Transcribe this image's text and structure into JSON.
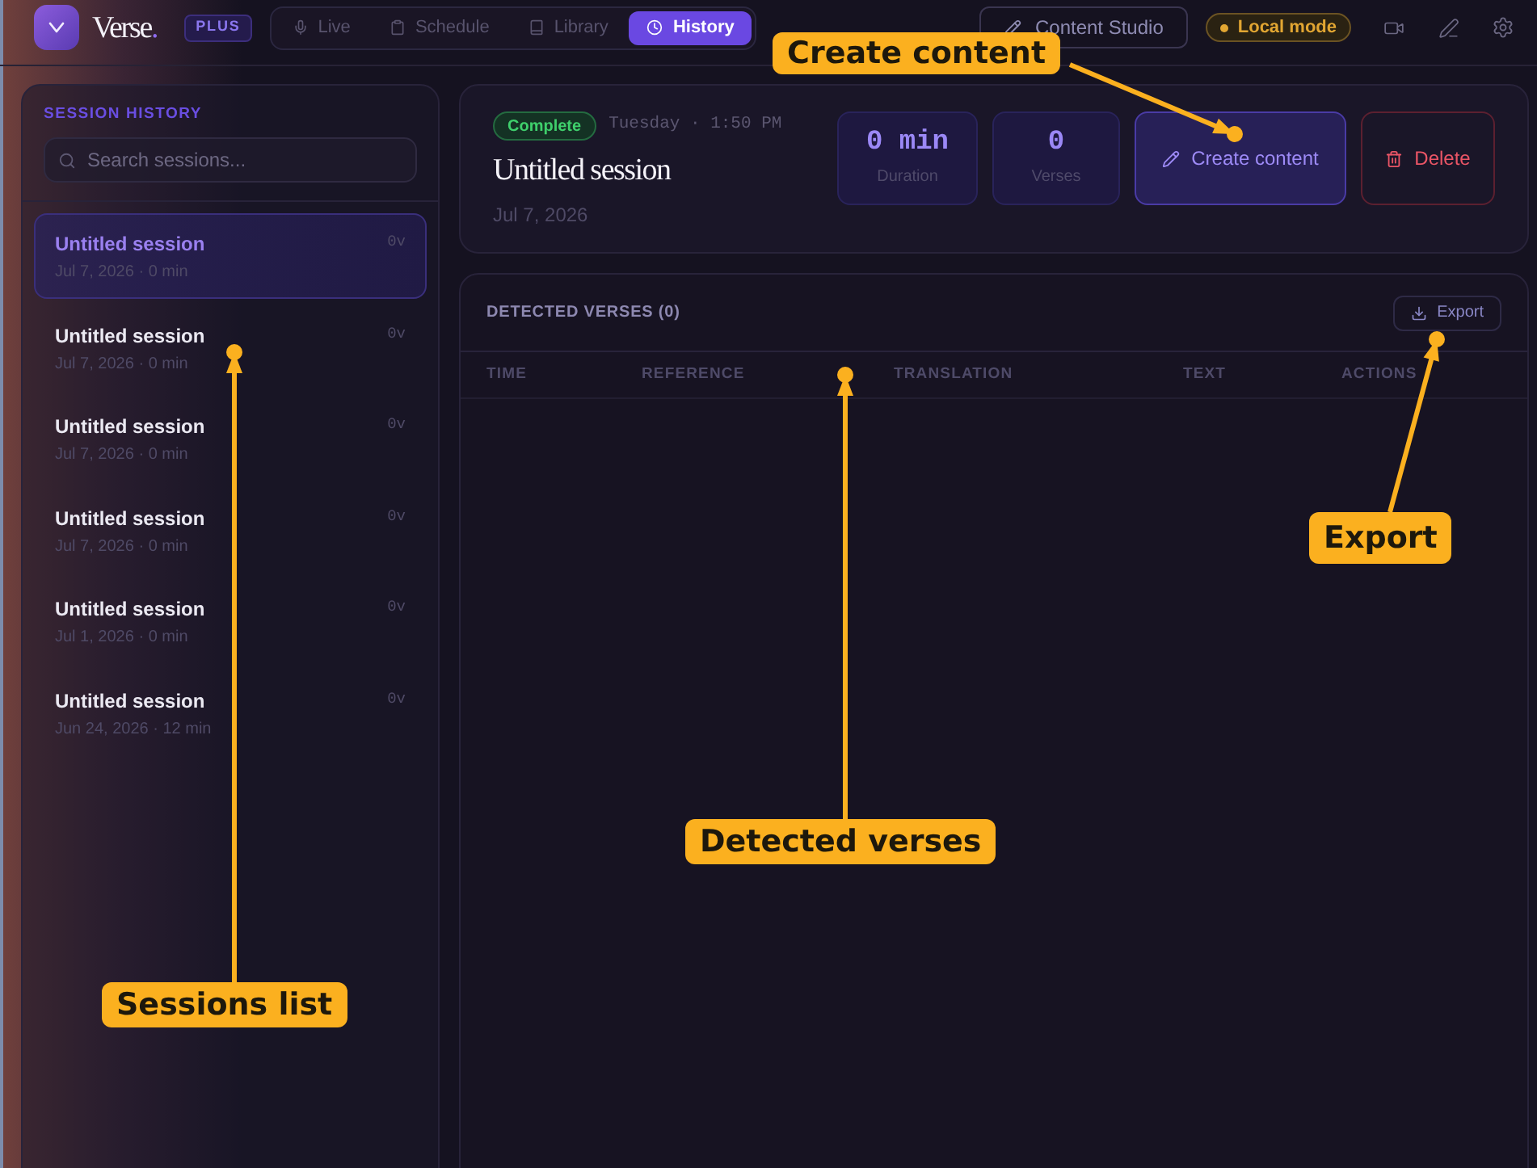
{
  "app": {
    "brand": "Verse",
    "brand_suffix": ".",
    "plan_badge": "PLUS"
  },
  "nav_tabs": [
    {
      "label": "Live",
      "selected": false
    },
    {
      "label": "Schedule",
      "selected": false
    },
    {
      "label": "Library",
      "selected": false
    },
    {
      "label": "History",
      "selected": true
    }
  ],
  "toolbar": {
    "content_studio": "Content Studio",
    "mode_badge": "Local mode"
  },
  "sidebar": {
    "title": "SESSION HISTORY",
    "search": {
      "placeholder": "Search sessions..."
    },
    "sessions": [
      {
        "title": "Untitled session",
        "meta": "Jul 7, 2026 · 0 min",
        "count": "0v",
        "selected": true
      },
      {
        "title": "Untitled session",
        "meta": "Jul 7, 2026 · 0 min",
        "count": "0v",
        "selected": false
      },
      {
        "title": "Untitled session",
        "meta": "Jul 7, 2026 · 0 min",
        "count": "0v",
        "selected": false
      },
      {
        "title": "Untitled session",
        "meta": "Jul 7, 2026 · 0 min",
        "count": "0v",
        "selected": false
      },
      {
        "title": "Untitled session",
        "meta": "Jul 1, 2026 · 0 min",
        "count": "0v",
        "selected": false
      },
      {
        "title": "Untitled session",
        "meta": "Jun 24, 2026 · 12 min",
        "count": "0v",
        "selected": false
      }
    ]
  },
  "session": {
    "status": "Complete",
    "time": "Tuesday · 1:50 PM",
    "title": "Untitled session",
    "date": "Jul 7, 2026",
    "stats": [
      {
        "value": "0 min",
        "label": "Duration"
      },
      {
        "value": "0",
        "label": "Verses"
      }
    ],
    "actions": [
      {
        "label": "Create content",
        "kind": "primary"
      },
      {
        "label": "Delete",
        "kind": "danger"
      }
    ]
  },
  "verses": {
    "title": "DETECTED VERSES (0)",
    "export": "Export",
    "columns": [
      "TIME",
      "REFERENCE",
      "TRANSLATION",
      "TEXT",
      "ACTIONS"
    ]
  },
  "annotations": [
    {
      "label": "Create content"
    },
    {
      "label": "Sessions list"
    },
    {
      "label": "Detected verses"
    },
    {
      "label": "Export"
    }
  ]
}
